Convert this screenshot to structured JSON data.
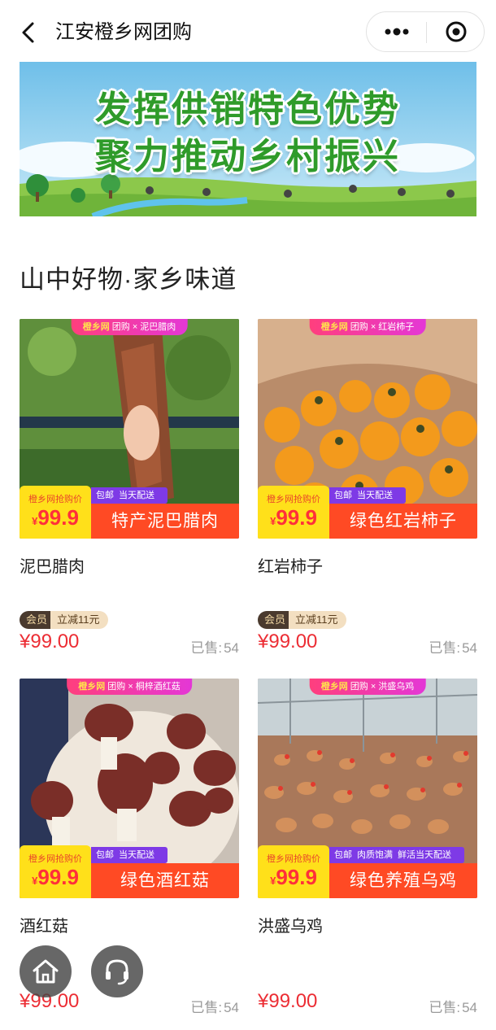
{
  "nav": {
    "title": "江安橙乡网团购",
    "back_icon": "chevron-left-icon",
    "more_icon": "more-dots-icon",
    "close_icon": "target-close-icon"
  },
  "banner": {
    "line1": "发挥供销特色优势",
    "line2": "聚力推动乡村振兴"
  },
  "section": {
    "title": "山中好物·家乡味道"
  },
  "labels": {
    "price_tag_label": "橙乡网抢购价",
    "currency_small": "¥",
    "sold_prefix": "已售:",
    "member_label": "会员"
  },
  "products": [
    {
      "name": "泥巴腊肉",
      "tag_brand": "橙乡网",
      "tag_rest": "团购 × 泥巴腊肉",
      "tag_price": "99.9",
      "badges": [
        "包邮",
        "当天配送"
      ],
      "banner_name": "特产泥巴腊肉",
      "member_discount": "立减11元",
      "price": "¥99.00",
      "sold": "54"
    },
    {
      "name": "红岩柿子",
      "tag_brand": "橙乡网",
      "tag_rest": "团购 × 红岩柿子",
      "tag_price": "99.9",
      "badges": [
        "包邮",
        "当天配送"
      ],
      "banner_name": "绿色红岩柿子",
      "member_discount": "立减11元",
      "price": "¥99.00",
      "sold": "54"
    },
    {
      "name": "酒红菇",
      "tag_brand": "橙乡网",
      "tag_rest": "团购 × 桐梓酒红菇",
      "tag_price": "99.9",
      "badges": [
        "包邮",
        "当天配送"
      ],
      "banner_name": "绿色酒红菇",
      "price": "¥99.00",
      "sold": "54"
    },
    {
      "name": "洪盛乌鸡",
      "tag_brand": "橙乡网",
      "tag_rest": "团购 × 洪盛乌鸡",
      "tag_price": "99.9",
      "badges": [
        "包邮",
        "肉质饱满",
        "鲜活当天配送"
      ],
      "banner_name": "绿色养殖乌鸡",
      "price": "¥99.00",
      "sold": "54"
    }
  ],
  "fab": {
    "home_icon": "home-icon",
    "service_icon": "headset-icon"
  },
  "colors": {
    "accent_red": "#ec2d34",
    "banner_green": "#2f9b2a",
    "badge_purple": "#7e3ae6",
    "price_yellow": "#ffe01a"
  }
}
